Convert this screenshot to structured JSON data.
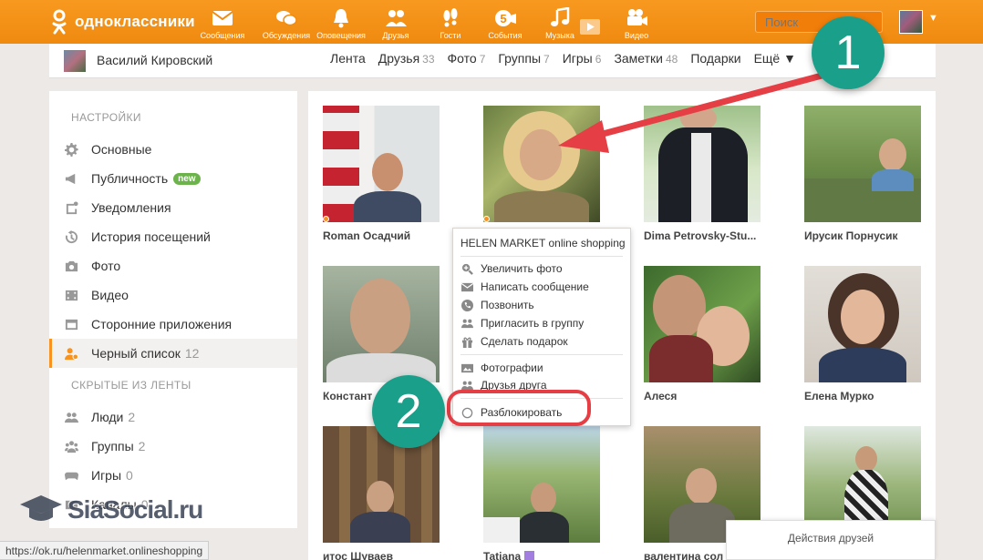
{
  "header": {
    "logo_text": "одноклассники",
    "nav": [
      {
        "label": "Сообщения",
        "icon": "envelope-icon"
      },
      {
        "label": "Обсуждения",
        "icon": "chat-bubbles-icon"
      },
      {
        "label": "Оповещения",
        "icon": "bell-icon"
      },
      {
        "label": "Друзья",
        "icon": "people-icon"
      },
      {
        "label": "Гости",
        "icon": "footprints-icon"
      },
      {
        "label": "События",
        "icon": "events-five-icon"
      },
      {
        "label": "Музыка",
        "icon": "music-note-icon"
      },
      {
        "label": "Видео",
        "icon": "video-camera-icon"
      }
    ],
    "search_placeholder": "Поиск",
    "colors": {
      "brand": "#f7931e"
    }
  },
  "profile_bar": {
    "name": "Василий Кировский",
    "tabs": [
      {
        "label": "Лента",
        "count": ""
      },
      {
        "label": "Друзья",
        "count": "33"
      },
      {
        "label": "Фото",
        "count": "7"
      },
      {
        "label": "Группы",
        "count": "7"
      },
      {
        "label": "Игры",
        "count": "6"
      },
      {
        "label": "Заметки",
        "count": "48"
      },
      {
        "label": "Подарки",
        "count": ""
      },
      {
        "label": "Ещё ▼",
        "count": ""
      }
    ]
  },
  "sidebar": {
    "settings_title": "НАСТРОЙКИ",
    "settings_items": [
      {
        "label": "Основные",
        "icon": "gear-icon",
        "count": ""
      },
      {
        "label": "Публичность",
        "icon": "megaphone-icon",
        "count": "",
        "badge": "new"
      },
      {
        "label": "Уведомления",
        "icon": "notification-icon",
        "count": ""
      },
      {
        "label": "История посещений",
        "icon": "history-icon",
        "count": ""
      },
      {
        "label": "Фото",
        "icon": "camera-icon",
        "count": ""
      },
      {
        "label": "Видео",
        "icon": "film-icon",
        "count": ""
      },
      {
        "label": "Сторонние приложения",
        "icon": "apps-icon",
        "count": ""
      },
      {
        "label": "Черный список",
        "icon": "blacklist-user-icon",
        "count": "12",
        "active": true
      }
    ],
    "hidden_title": "СКРЫТЫЕ ИЗ ЛЕНТЫ",
    "hidden_items": [
      {
        "label": "Люди",
        "icon": "people-icon",
        "count": "2"
      },
      {
        "label": "Группы",
        "icon": "groups-icon",
        "count": "2"
      },
      {
        "label": "Игры",
        "icon": "gamepad-icon",
        "count": "0"
      },
      {
        "label": "Каналы",
        "icon": "channel-icon",
        "count": "0"
      }
    ]
  },
  "blocked_users": [
    {
      "name": "Roman Осадчий",
      "online": true
    },
    {
      "name": "",
      "online": true
    },
    {
      "name": "Dima Petrovsky-Stu...",
      "online": false
    },
    {
      "name": "Ирусик Порнусик",
      "online": false
    },
    {
      "name": "Констант",
      "online": false
    },
    {
      "name": "",
      "online": false
    },
    {
      "name": "Алеся",
      "online": false
    },
    {
      "name": "Елена Мурко",
      "online": false
    },
    {
      "name": "итос Шуваев",
      "online": false
    },
    {
      "name": "Tatiana",
      "online": false,
      "vip": true
    },
    {
      "name": "валентина сол",
      "online": false
    },
    {
      "name": "",
      "online": false
    }
  ],
  "popup": {
    "title": "HELEN MARKET online shopping",
    "items": [
      {
        "label": "Увеличить фото",
        "icon": "zoom-icon"
      },
      {
        "label": "Написать сообщение",
        "icon": "envelope-icon"
      },
      {
        "label": "Позвонить",
        "icon": "phone-icon"
      },
      {
        "label": "Пригласить в группу",
        "icon": "group-invite-icon"
      },
      {
        "label": "Сделать подарок",
        "icon": "gift-icon"
      }
    ],
    "items2": [
      {
        "label": "Фотографии",
        "icon": "photo-icon"
      },
      {
        "label": "Друзья друга",
        "icon": "friends-icon"
      }
    ],
    "unblock_label": "Разблокировать"
  },
  "annotations": {
    "marker1": "1",
    "marker2": "2",
    "colors": {
      "marker": "#1aa08a",
      "arrow": "#e53e45"
    }
  },
  "friends_actions_label": "Действия друзей",
  "status_url": "https://ok.ru/helenmarket.onlineshopping",
  "watermark_text": "SiaSocial.ru"
}
